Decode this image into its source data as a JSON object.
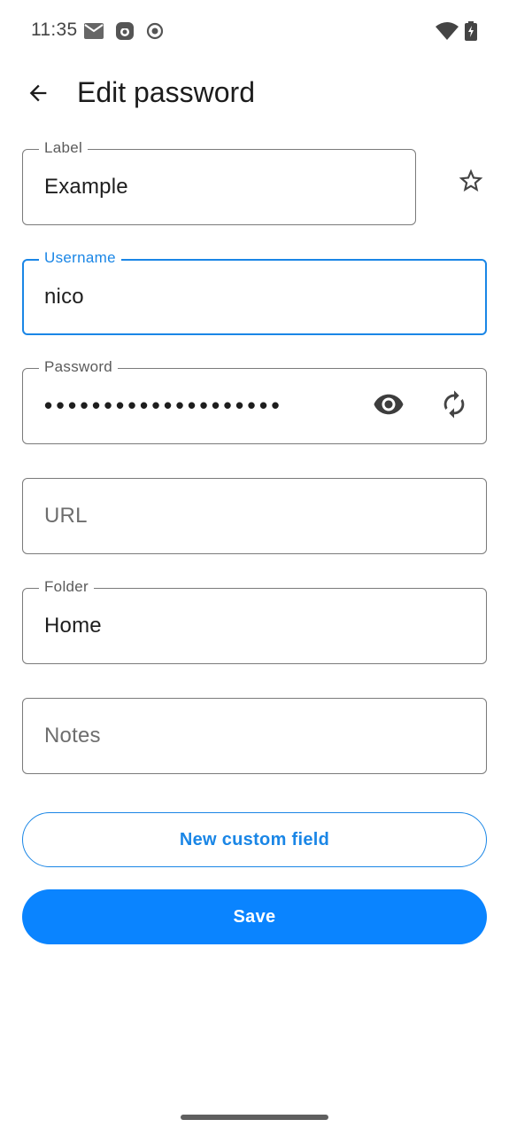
{
  "status_bar": {
    "time": "11:35",
    "icons": [
      "mail-icon",
      "app-notification-icon",
      "record-icon",
      "wifi-icon",
      "battery-charging-icon"
    ]
  },
  "app_bar": {
    "back_icon": "arrow-back-icon",
    "title": "Edit password"
  },
  "form": {
    "label": {
      "label": "Label",
      "value": "Example",
      "favorite_icon": "star-outline-icon"
    },
    "username": {
      "label": "Username",
      "value": "nico"
    },
    "password": {
      "label": "Password",
      "value": "••••••••••••••••••••",
      "show_icon": "eye-icon",
      "generate_icon": "refresh-icon"
    },
    "url": {
      "placeholder": "URL"
    },
    "folder": {
      "label": "Folder",
      "value": "Home"
    },
    "notes": {
      "placeholder": "Notes"
    }
  },
  "actions": {
    "new_custom_field": "New custom field",
    "save": "Save"
  },
  "colors": {
    "accent": "#1a86e6",
    "primary_button": "#0a84ff"
  }
}
